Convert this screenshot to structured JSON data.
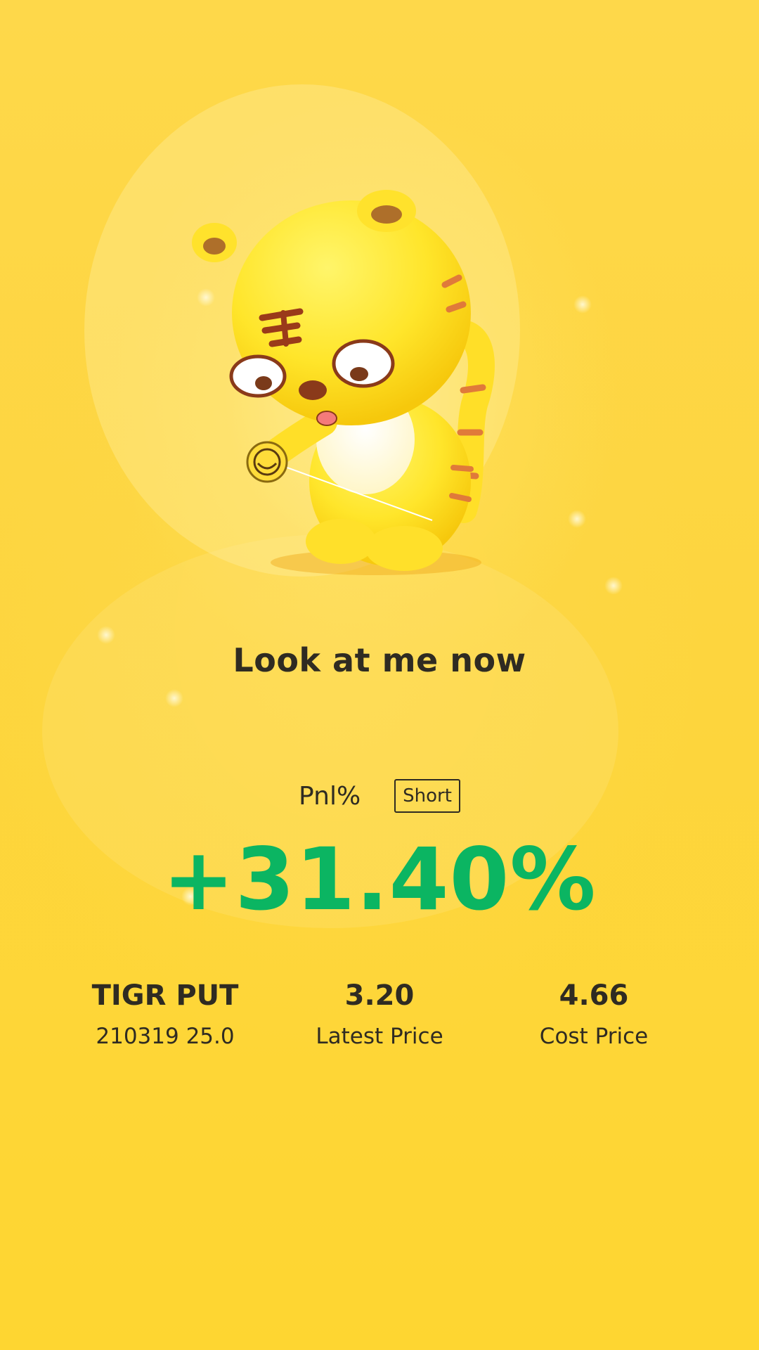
{
  "share_card": {
    "headline": "Look at me now",
    "pnl_label": "Pnl%",
    "position_badge": "Short",
    "pnl_value": "+31.40%",
    "pnl_color": "#0bb562",
    "background_color": "#fed736",
    "mascot": "yellow-tiger-yoyo-mascot"
  },
  "stats": [
    {
      "main": "TIGR PUT",
      "sub": "210319 25.0"
    },
    {
      "main": "3.20",
      "sub": "Latest Price"
    },
    {
      "main": "4.66",
      "sub": "Cost Price"
    }
  ]
}
